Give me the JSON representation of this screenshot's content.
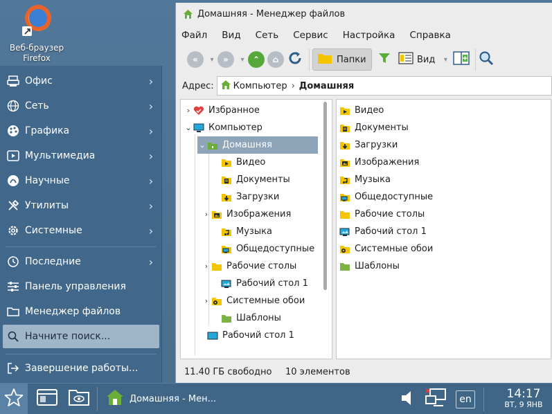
{
  "desktop": {
    "icon_label_line1": "Веб-браузер",
    "icon_label_line2": "Firefox"
  },
  "start_menu": {
    "items": [
      {
        "label": "Офис",
        "icon": "office-icon",
        "has_submenu": true
      },
      {
        "label": "Сеть",
        "icon": "globe-icon",
        "has_submenu": true
      },
      {
        "label": "Графика",
        "icon": "palette-icon",
        "has_submenu": true
      },
      {
        "label": "Мультимедиа",
        "icon": "play-icon",
        "has_submenu": true
      },
      {
        "label": "Научные",
        "icon": "science-icon",
        "has_submenu": true
      },
      {
        "label": "Утилиты",
        "icon": "tools-icon",
        "has_submenu": true
      },
      {
        "label": "Системные",
        "icon": "gear-icon",
        "has_submenu": true
      },
      {
        "label": "Последние",
        "icon": "history-icon",
        "has_submenu": true
      },
      {
        "label": "Панель управления",
        "icon": "sliders-icon",
        "has_submenu": false
      },
      {
        "label": "Менеджер файлов",
        "icon": "folder-icon",
        "has_submenu": false
      },
      {
        "label": "Начните поиск...",
        "icon": "search-icon",
        "has_submenu": false
      },
      {
        "label": "Завершение работы...",
        "icon": "logout-icon",
        "has_submenu": false
      }
    ]
  },
  "window": {
    "title": "Домашняя - Менеджер файлов",
    "menu": [
      "Файл",
      "Вид",
      "Сеть",
      "Сервис",
      "Настройка",
      "Справка"
    ],
    "toolbar": {
      "folders_label": "Папки",
      "view_label": "Вид"
    },
    "address": {
      "label": "Адрес:",
      "crumbs": [
        "Компьютер",
        "Домашняя"
      ]
    },
    "tree": [
      {
        "label": "Избранное",
        "icon": "favorites-icon",
        "depth": 0,
        "expander": ">"
      },
      {
        "label": "Компьютер",
        "icon": "computer-icon",
        "depth": 0,
        "expander": "v"
      },
      {
        "label": "Домашняя",
        "icon": "home-folder-icon",
        "depth": 1,
        "expander": "v",
        "selected": true
      },
      {
        "label": "Видео",
        "icon": "video-folder-icon",
        "depth": 2,
        "expander": ""
      },
      {
        "label": "Документы",
        "icon": "documents-folder-icon",
        "depth": 2,
        "expander": ""
      },
      {
        "label": "Загрузки",
        "icon": "downloads-folder-icon",
        "depth": 2,
        "expander": ""
      },
      {
        "label": "Изображения",
        "icon": "pictures-folder-icon",
        "depth": 2,
        "expander": ">"
      },
      {
        "label": "Музыка",
        "icon": "music-folder-icon",
        "depth": 2,
        "expander": ""
      },
      {
        "label": "Общедоступные",
        "icon": "public-folder-icon",
        "depth": 2,
        "expander": ""
      },
      {
        "label": "Рабочие столы",
        "icon": "folder-icon",
        "depth": 2,
        "expander": ">"
      },
      {
        "label": "Рабочий стол 1",
        "icon": "desktop-folder-icon",
        "depth": 2,
        "expander": ""
      },
      {
        "label": "Системные обои",
        "icon": "wallpaper-folder-icon",
        "depth": 2,
        "expander": ">"
      },
      {
        "label": "Шаблоны",
        "icon": "templates-folder-icon",
        "depth": 2,
        "expander": ""
      },
      {
        "label": "Рабочий стол 1",
        "icon": "desktop-icon",
        "depth": 1,
        "expander": ""
      }
    ],
    "files": [
      {
        "label": "Видео",
        "icon": "video-folder-icon"
      },
      {
        "label": "Документы",
        "icon": "documents-folder-icon"
      },
      {
        "label": "Загрузки",
        "icon": "downloads-folder-icon"
      },
      {
        "label": "Изображения",
        "icon": "pictures-folder-icon"
      },
      {
        "label": "Музыка",
        "icon": "music-folder-icon"
      },
      {
        "label": "Общедоступные",
        "icon": "public-folder-icon"
      },
      {
        "label": "Рабочие столы",
        "icon": "folder-icon"
      },
      {
        "label": "Рабочий стол 1",
        "icon": "desktop-folder-icon"
      },
      {
        "label": "Системные обои",
        "icon": "wallpaper-folder-icon"
      },
      {
        "label": "Шаблоны",
        "icon": "templates-folder-icon"
      }
    ],
    "status": {
      "free": "11.40 ГБ свободно",
      "count": "10 элементов"
    }
  },
  "taskbar": {
    "task_label": "Домашняя - Мен...",
    "lang": "en",
    "time": "14:17",
    "date": "ВТ, 9 ЯНВ"
  },
  "colors": {
    "folder_yellow": "#f5c400",
    "selected": "#8ea4b9",
    "desktop_bg": "#4d7290",
    "menu_bg": "#41678a"
  }
}
